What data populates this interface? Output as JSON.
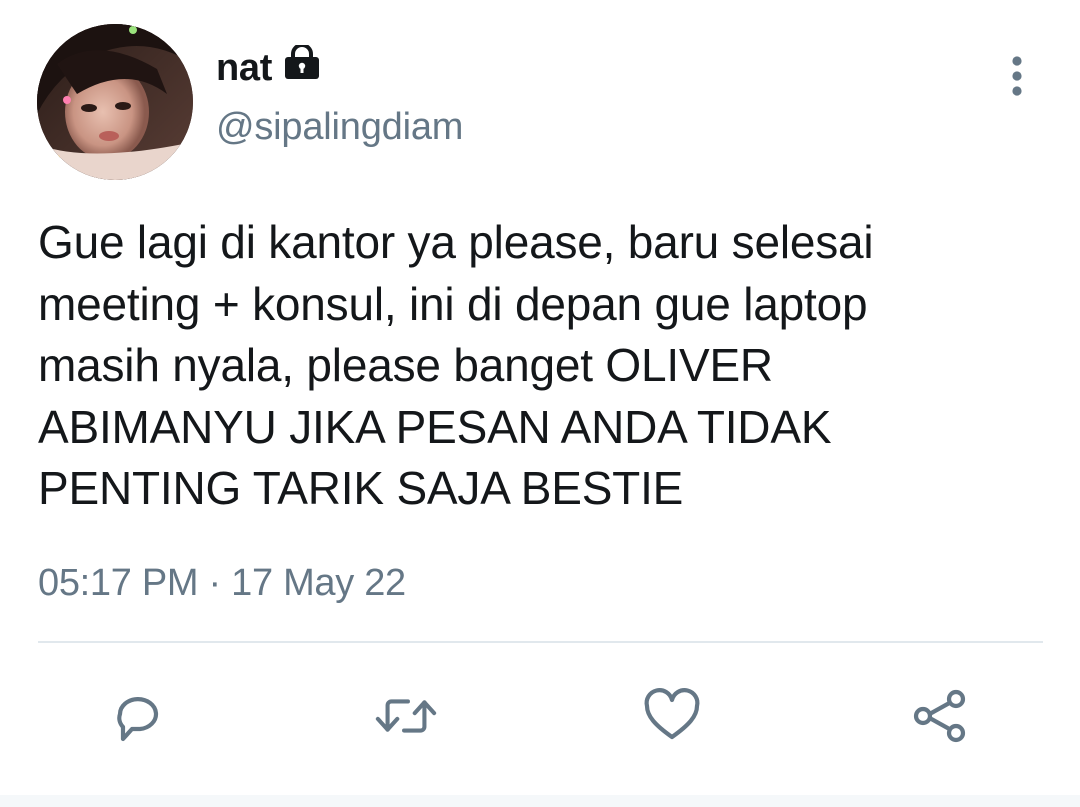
{
  "tweet": {
    "display_name": "nat",
    "handle": "@sipalingdiam",
    "text": "Gue lagi di kantor ya please, baru selesai\nmeeting + konsul, ini di depan gue laptop\nmasih nyala, please banget OLIVER\nABIMANYU JIKA PESAN ANDA TIDAK\nPENTING TARIK SAJA BESTIE",
    "time": "05:17 PM",
    "separator": "·",
    "date": "17 May 22",
    "protected_account": true
  },
  "icons": {
    "lock": "lock-icon",
    "more": "more-vertical-icon",
    "reply": "reply-icon",
    "retweet": "retweet-icon",
    "like": "heart-icon",
    "share": "share-icon"
  },
  "colors": {
    "text_primary": "#14171a",
    "text_secondary": "#657786",
    "icon": "#657786",
    "divider": "#e1e8ed"
  }
}
